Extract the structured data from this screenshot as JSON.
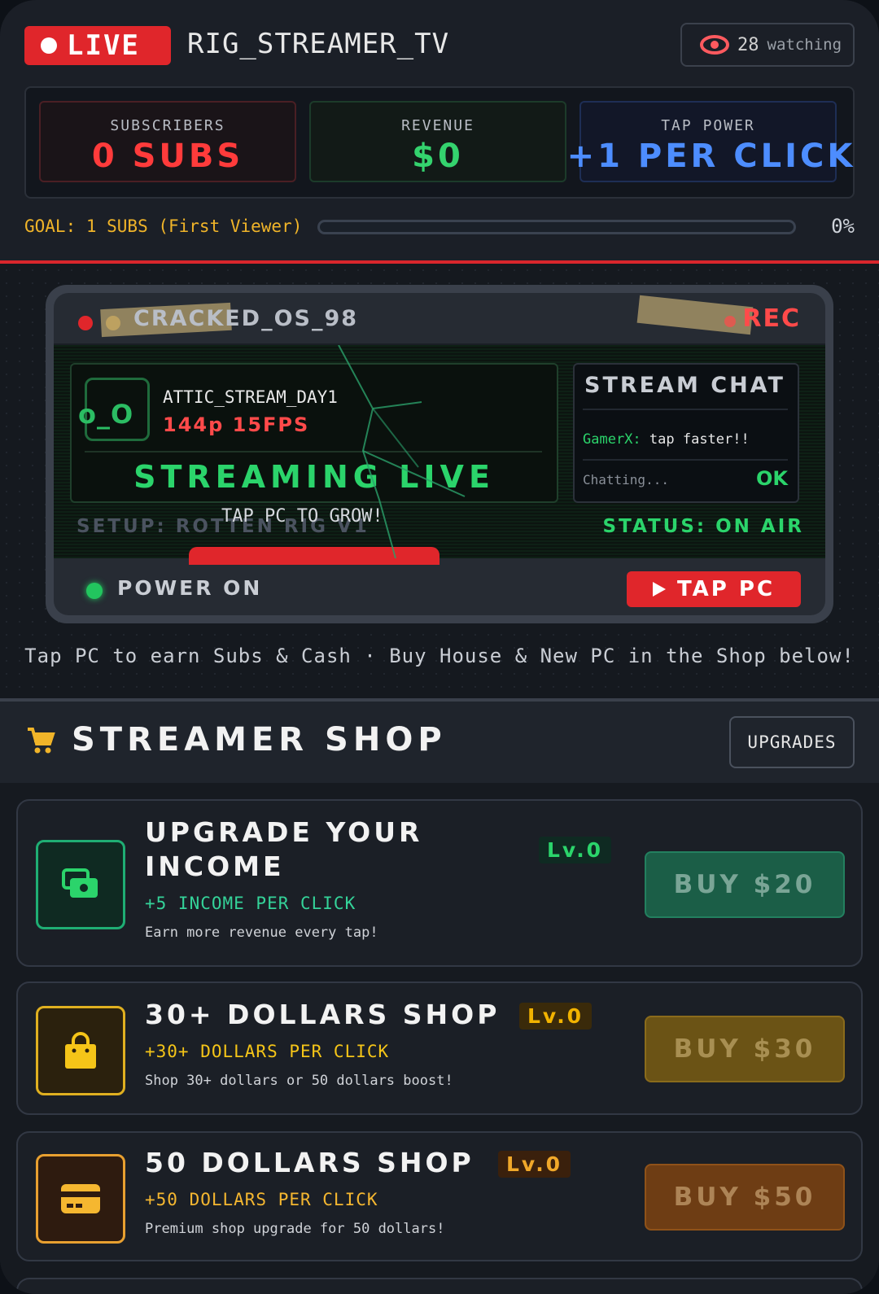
{
  "header": {
    "live_label": "LIVE",
    "channel_name": "RIG_STREAMER_TV",
    "watch_count": "28",
    "watch_label": "watching"
  },
  "stats": {
    "subscribers": {
      "label": "SUBSCRIBERS",
      "value": "0 SUBS",
      "color": "#ff3b3b"
    },
    "revenue": {
      "label": "REVENUE",
      "value": "$0",
      "color": "#34d36e"
    },
    "tap_power": {
      "label": "TAP POWER",
      "value": "+1 PER CLICK",
      "color": "#4d8dff"
    }
  },
  "goal": {
    "label": "GOAL: 1 SUBS (First Viewer)",
    "percent_text": "0%",
    "progress": 0
  },
  "pc": {
    "os_name": "CRACKED_OS_98",
    "rec_label": "REC",
    "face": "o_O",
    "stream_name": "ATTIC_STREAM_DAY1",
    "quality": "144p 15FPS",
    "streaming_label": "STREAMING LIVE",
    "chat": {
      "title": "STREAM CHAT",
      "message_user": "GamerX:",
      "message_text": "tap faster!!",
      "typing": "Chatting...",
      "ok": "OK"
    },
    "setup": "SETUP: ROTTEN RIG V1",
    "tap_hint": "TAP PC TO GROW!",
    "status": "STATUS: ON AIR",
    "power_label": "POWER ON",
    "tap_button": "TAP PC"
  },
  "instruction": "Tap PC to earn Subs & Cash · Buy House & New PC in the Shop below!",
  "shop": {
    "title": "STREAMER SHOP",
    "upgrades_button": "UPGRADES",
    "items": [
      {
        "title_line1": "UPGRADE YOUR",
        "title_line2": "INCOME",
        "level": "Lv.0",
        "perk": "+5 INCOME PER CLICK",
        "desc": "Earn more revenue every tap!",
        "buy": "BUY $20",
        "icon": "cash-icon"
      },
      {
        "title_line1": "30+ DOLLARS SHOP",
        "level": "Lv.0",
        "perk": "+30+ DOLLARS PER CLICK",
        "desc": "Shop 30+ dollars or 50 dollars boost!",
        "buy": "BUY $30",
        "icon": "shopping-bag-icon"
      },
      {
        "title_line1": "50 DOLLARS SHOP",
        "level": "Lv.0",
        "perk": "+50 DOLLARS PER CLICK",
        "desc": "Premium shop upgrade for 50 dollars!",
        "buy": "BUY $50",
        "icon": "credit-card-icon"
      }
    ]
  },
  "colors": {
    "accent_red": "#e0262b",
    "accent_green": "#2bd46b",
    "accent_gold": "#f0b429",
    "background": "#1b1f27"
  }
}
